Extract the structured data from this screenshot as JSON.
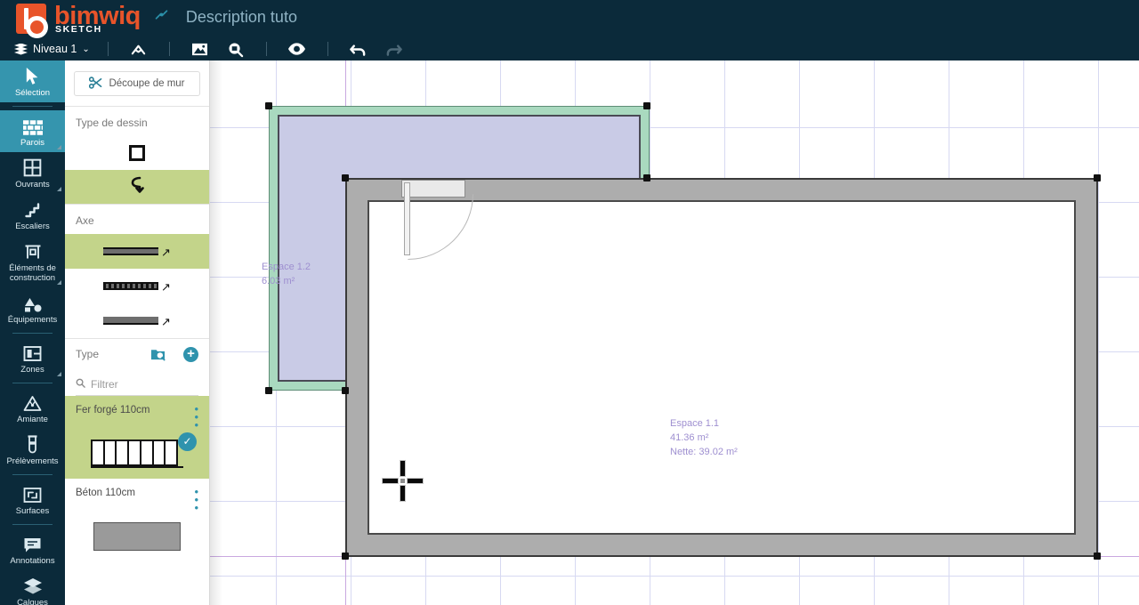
{
  "app": {
    "brand_name": "bimwiq",
    "brand_sub": "SKETCH",
    "title_icon": "link-icon",
    "document_title": "Description tuto"
  },
  "toolbar": {
    "level_label": "Niveau 1",
    "level_icon": "layers-icon",
    "chevron": "⌄",
    "buttons": [
      {
        "name": "measure-angle-icon",
        "label": ""
      },
      {
        "name": "image-icon",
        "label": ""
      },
      {
        "name": "zoom-measure-icon",
        "label": ""
      },
      {
        "name": "eye-visibility-icon",
        "label": ""
      },
      {
        "name": "undo-icon",
        "label": ""
      },
      {
        "name": "redo-icon",
        "label": ""
      }
    ]
  },
  "sidebar": {
    "items": [
      {
        "id": "selection",
        "label": "Sélection",
        "icon": "cursor-arrow-icon",
        "active": true,
        "caret": false
      },
      {
        "id": "parois",
        "label": "Parois",
        "icon": "brick-wall-icon",
        "active": true,
        "caret": true
      },
      {
        "id": "ouvrants",
        "label": "Ouvrants",
        "icon": "window-icon",
        "active": false,
        "caret": true
      },
      {
        "id": "escaliers",
        "label": "Escaliers",
        "icon": "stairs-icon",
        "active": false,
        "caret": false
      },
      {
        "id": "elements",
        "label": "Éléments de construction",
        "icon": "construction-icon",
        "active": false,
        "caret": true
      },
      {
        "id": "equipements",
        "label": "Équipements",
        "icon": "shapes-icon",
        "active": false,
        "caret": false
      },
      {
        "id": "zones",
        "label": "Zones",
        "icon": "zones-icon",
        "active": false,
        "caret": true
      },
      {
        "id": "amiante",
        "label": "Amiante",
        "icon": "warning-triangle-icon",
        "active": false,
        "caret": false
      },
      {
        "id": "prelevements",
        "label": "Prélèvements",
        "icon": "test-tube-icon",
        "active": false,
        "caret": false
      },
      {
        "id": "surfaces",
        "label": "Surfaces",
        "icon": "surface-expand-icon",
        "active": false,
        "caret": false
      },
      {
        "id": "annotations",
        "label": "Annotations",
        "icon": "comment-icon",
        "active": false,
        "caret": false
      },
      {
        "id": "calques",
        "label": "Calques",
        "icon": "layers-stack-icon",
        "active": false,
        "caret": false
      }
    ]
  },
  "panel": {
    "cut_wall_button": "Découpe de mur",
    "cut_wall_icon": "scissors-icon",
    "draw_type_label": "Type de dessin",
    "draw_types": [
      {
        "id": "rect",
        "icon": "rectangle-icon",
        "selected": false
      },
      {
        "id": "polygon",
        "icon": "polyline-icon",
        "selected": true
      }
    ],
    "axis_label": "Axe",
    "axis_options": [
      {
        "id": "center",
        "icon": "wall-axis-center-icon",
        "selected": true
      },
      {
        "id": "dashed",
        "icon": "wall-axis-dashed-icon",
        "selected": false
      },
      {
        "id": "outside",
        "icon": "wall-axis-outside-icon",
        "selected": false
      }
    ],
    "type_label": "Type",
    "catalog_icon": "catalog-search-icon",
    "add_icon": "plus-circle-icon",
    "filter_placeholder": "Filtrer",
    "filter_value": "",
    "filter_icon": "search-icon",
    "items": [
      {
        "id": "fer-forge",
        "title": "Fer forgé 110cm",
        "selected": true,
        "checked": true,
        "art": "railing",
        "menu_icon": "kebab-menu-icon"
      },
      {
        "id": "beton",
        "title": "Béton 110cm",
        "selected": false,
        "checked": false,
        "art": "solid",
        "menu_icon": "kebab-menu-icon"
      }
    ]
  },
  "canvas": {
    "spaces": [
      {
        "id": "espace-1-2",
        "name": "Espace 1.2",
        "area": "6.03 m²",
        "net": ""
      },
      {
        "id": "espace-1-1",
        "name": "Espace 1.1",
        "area": "41.36 m²",
        "net": "Nette: 39.02 m²"
      }
    ],
    "cursor": "crosshair-cursor"
  },
  "colors": {
    "header_bg": "#0b2a3a",
    "accent_teal": "#2f93ad",
    "brand_orange": "#e8542a",
    "selection_green": "#c3d48a",
    "space_fill": "#c9cbe6",
    "space_wall_selected": "#a9d9bf",
    "wall_fill": "#adadad",
    "label_purple": "#9e8fd0",
    "grid_line": "#d7d9f2",
    "axis_line": "#c9a8e0"
  }
}
